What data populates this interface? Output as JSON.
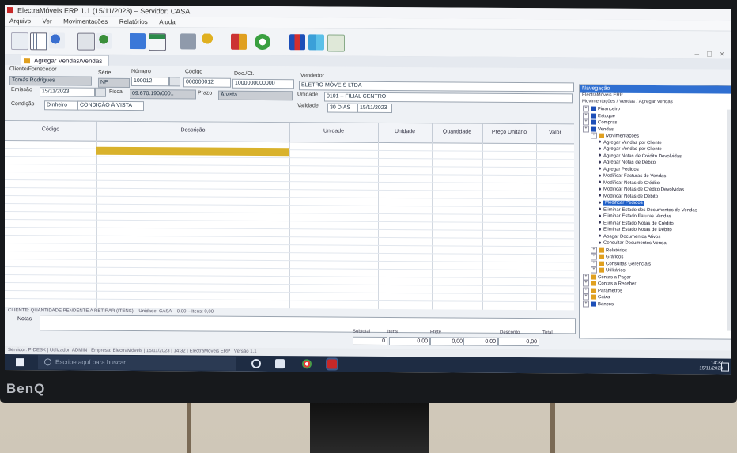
{
  "window": {
    "title": "ElectraMóveis ERP 1.1 (15/11/2023) – Servidor: CASA"
  },
  "menu": [
    "Arquivo",
    "Ver",
    "Movimentações",
    "Relatórios",
    "Ajuda"
  ],
  "tab": {
    "label": "Agregar Vendas/Vendas"
  },
  "form": {
    "cliente_label": "Cliente/Fornecedor",
    "cliente_value": "Tomás Rodrigues",
    "serie_label": "Série",
    "serie_value": "NF",
    "numero_label": "Número",
    "numero_value": "100012",
    "codigo_label": "Código",
    "codigo_value": "000000012",
    "emissao_label": "Emissão",
    "emissao_value": "15/11/2023",
    "doc_label": "Doc./Ct.",
    "doc_value": "1000000000000",
    "vendedor_label": "Vendedor",
    "vendedor_value": "ELETRO MÓVEIS LTDA",
    "fiscal_label": "Fiscal",
    "fiscal_value": "09.670.190/0001",
    "unidade_label": "Unidade",
    "unidade_value": "0101 – FILIAL CENTRO",
    "prazo_label": "Prazo",
    "prazo_value": "À vista",
    "condicao_label": "Condição",
    "condicao_value": "Dinheiro",
    "condicao_desc": "CONDIÇÃO À VISTA",
    "validade_label": "Validade",
    "validade_value": "30 DIAS",
    "data_value": "15/11/2023"
  },
  "grid": {
    "columns": [
      "Código",
      "Descrição",
      "Unidade",
      "Unidade",
      "Quantidade",
      "Preço Unitário",
      "Valor"
    ]
  },
  "status_line": "CLIENTE: QUANTIDADE PENDENTE A RETIRAR (ITENS) – Unidade: CASA – 0,00 – Itens: 0,00",
  "notes_label": "Notas",
  "totals": {
    "labels": [
      "Subtotal",
      "Itens",
      "Frete",
      "Desconto",
      "Total"
    ],
    "values": [
      "0",
      "0,00",
      "0,00",
      "0,00",
      "0,00"
    ]
  },
  "tree": {
    "header": "Navegação",
    "subtitle": "ElectraMóveis ERP",
    "subtitle2": "Movimentações / Vendas / Agregar Vendas",
    "items": [
      {
        "label": "Financeiro",
        "level": 0,
        "type": "folder",
        "color": "#1d4fb8"
      },
      {
        "label": "Estoque",
        "level": 0,
        "type": "folder",
        "color": "#1d4fb8"
      },
      {
        "label": "Compras",
        "level": 0,
        "type": "folder",
        "color": "#1d4fb8"
      },
      {
        "label": "Vendas",
        "level": 0,
        "type": "folder",
        "color": "#1d4fb8"
      },
      {
        "label": "Movimentações",
        "level": 1,
        "type": "folder",
        "color": "#e0a020"
      },
      {
        "label": "Agregar Vendas por Cliente",
        "level": 2,
        "type": "leaf"
      },
      {
        "label": "Agregar Vendas por Cliente",
        "level": 2,
        "type": "leaf"
      },
      {
        "label": "Agregar Notas de Crédito Devolvidas",
        "level": 2,
        "type": "leaf"
      },
      {
        "label": "Agregar Notas de Débito",
        "level": 2,
        "type": "leaf"
      },
      {
        "label": "Agregar Pedidos",
        "level": 2,
        "type": "leaf"
      },
      {
        "label": "Modificar Facturas de Vendas",
        "level": 2,
        "type": "leaf"
      },
      {
        "label": "Modificar Notas de Crédito",
        "level": 2,
        "type": "leaf"
      },
      {
        "label": "Modificar Notas de Crédito Devolvidas",
        "level": 2,
        "type": "leaf"
      },
      {
        "label": "Modificar Notas de Débito",
        "level": 2,
        "type": "leaf"
      },
      {
        "label": "Modificar Pedidos",
        "level": 2,
        "type": "leaf",
        "selected": true
      },
      {
        "label": "Eliminar Estado dos Documentos de Vendas",
        "level": 2,
        "type": "leaf"
      },
      {
        "label": "Eliminar Estado Faturas Vendas",
        "level": 2,
        "type": "leaf"
      },
      {
        "label": "Eliminar Estado Notas de Crédito",
        "level": 2,
        "type": "leaf"
      },
      {
        "label": "Eliminar Estado Notas de Débito",
        "level": 2,
        "type": "leaf"
      },
      {
        "label": "Apagar Documentos Ativos",
        "level": 2,
        "type": "leaf"
      },
      {
        "label": "Consultar Documentos Venda",
        "level": 2,
        "type": "leaf"
      },
      {
        "label": "Relatórios",
        "level": 1,
        "type": "folder",
        "color": "#e0a020"
      },
      {
        "label": "Gráficos",
        "level": 1,
        "type": "folder",
        "color": "#e0a020"
      },
      {
        "label": "Consultas Gerenciais",
        "level": 1,
        "type": "folder",
        "color": "#e0a020"
      },
      {
        "label": "Utilitários",
        "level": 1,
        "type": "folder",
        "color": "#e0a020"
      },
      {
        "label": "Contas a Pagar",
        "level": 0,
        "type": "folder",
        "color": "#e0a020"
      },
      {
        "label": "Contas a Receber",
        "level": 0,
        "type": "folder",
        "color": "#e0a020"
      },
      {
        "label": "Parâmetros",
        "level": 0,
        "type": "folder",
        "color": "#e0a020"
      },
      {
        "label": "Caixa",
        "level": 0,
        "type": "folder",
        "color": "#e0a020"
      },
      {
        "label": "Bancos",
        "level": 0,
        "type": "folder",
        "color": "#1d4fb8"
      }
    ]
  },
  "status_bar": "Servidor: P-DESK  |  Utilizador: ADMIN  |  Empresa: ElectraMóveis  |  15/11/2023  |  14:32  |  ElectraMóveis ERP  |  Versão 1.1",
  "taskbar": {
    "search_placeholder": "Escribe aquí para buscar",
    "time": "14:32",
    "date": "15/11/2023"
  },
  "monitor_brand": "BenQ"
}
